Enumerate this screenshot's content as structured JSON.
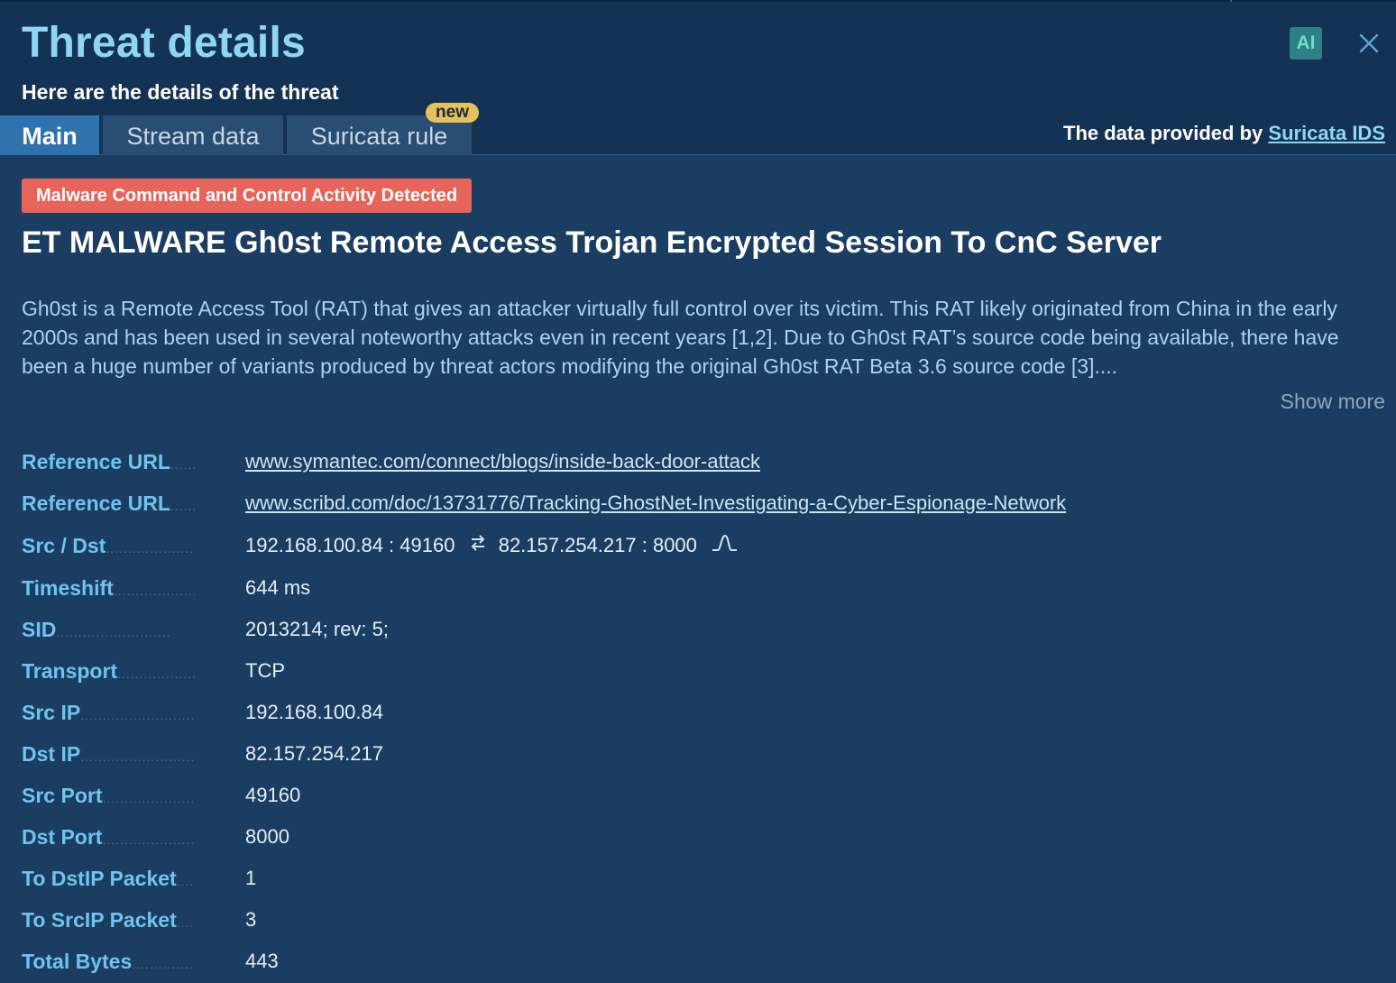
{
  "header": {
    "title": "Threat details",
    "subtitle": "Here are the details of the threat",
    "ai_label": "AI",
    "tabs": [
      {
        "label": "Main",
        "active": true
      },
      {
        "label": "Stream data",
        "active": false
      },
      {
        "label": "Suricata rule",
        "active": false,
        "badge": "new"
      }
    ],
    "provided_prefix": "The data provided by",
    "provided_link": "Suricata IDS"
  },
  "threat": {
    "category": "Malware Command and Control Activity Detected",
    "name": "ET MALWARE Gh0st Remote Access Trojan Encrypted Session To CnC Server",
    "description": "Gh0st is a Remote Access Tool (RAT) that gives an attacker virtually full control over its victim. This RAT likely originated from China in the early 2000s and has been used in several noteworthy attacks even in recent years [1,2]. Due to Gh0st RAT’s source code being available, there have been a huge number of variants produced by threat actors modifying the original Gh0st RAT Beta 3.6 source code [3]....",
    "show_more": "Show more"
  },
  "details": [
    {
      "label": "Reference URL",
      "value": "www.symantec.com/connect/blogs/inside-back-door-attack"
    },
    {
      "label": "Reference URL",
      "value": "www.scribd.com/doc/13731776/Tracking-GhostNet-Investigating-a-Cyber-Espionage-Network"
    },
    {
      "label": "Src / Dst",
      "src": "192.168.100.84 : 49160",
      "dst": "82.157.254.217 : 8000"
    },
    {
      "label": "Timeshift",
      "value": "644 ms"
    },
    {
      "label": "SID",
      "value": "2013214; rev: 5;"
    },
    {
      "label": "Transport",
      "value": "TCP"
    },
    {
      "label": "Src IP",
      "value": "192.168.100.84"
    },
    {
      "label": "Dst IP",
      "value": "82.157.254.217"
    },
    {
      "label": "Src Port",
      "value": "49160"
    },
    {
      "label": "Dst Port",
      "value": "8000"
    },
    {
      "label": "To DstIP Packet",
      "value": "1"
    },
    {
      "label": "To SrcIP Packet",
      "value": "3"
    },
    {
      "label": "Total Bytes",
      "value": "443"
    }
  ],
  "colors": {
    "panel_bg": "#1b3d62",
    "header_bg": "#143254",
    "accent": "#8fd6f2",
    "label": "#6fc3ee",
    "badge_red": "#e8645a",
    "badge_new": "#e5c15c",
    "active_tab": "#2f72ad"
  },
  "icons": {
    "close": "close-icon",
    "swap": "swap-arrows-icon",
    "wave": "waveform-icon"
  }
}
